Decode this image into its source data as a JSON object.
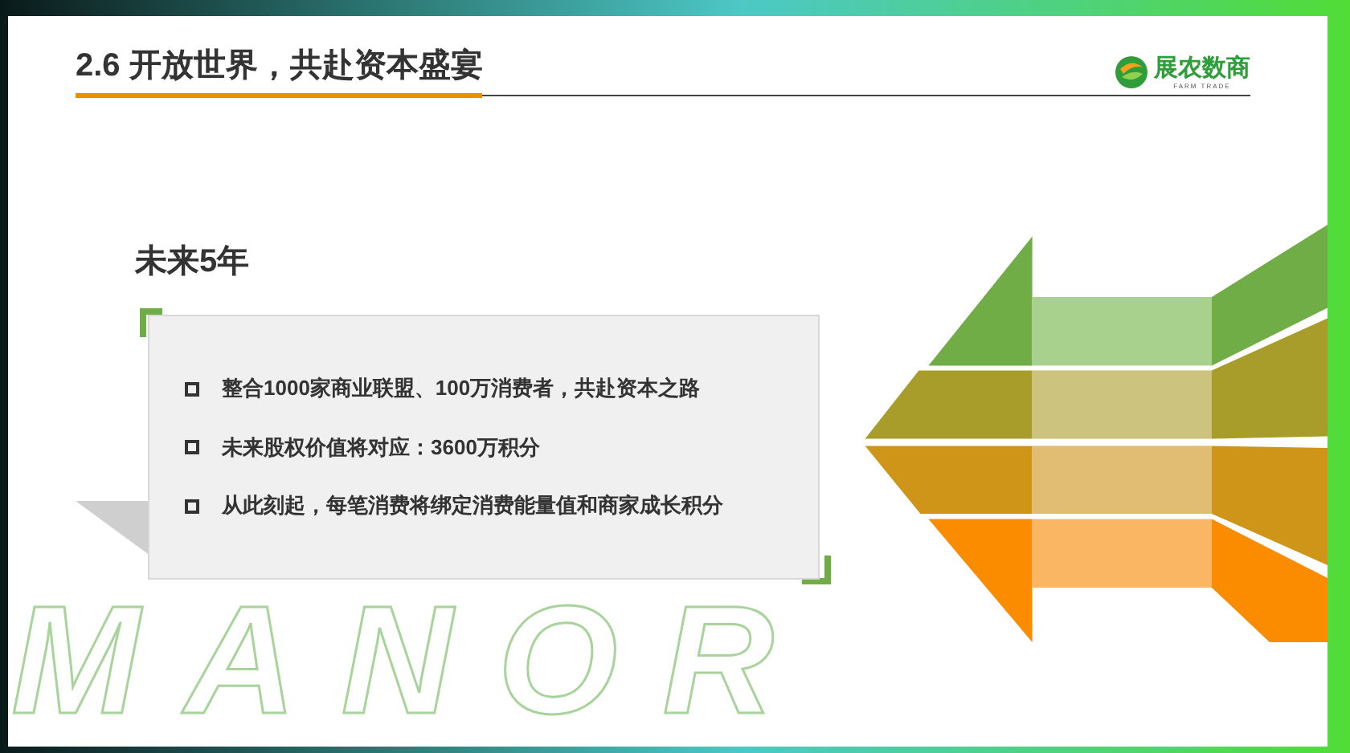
{
  "header": {
    "title": "2.6 开放世界，共赴资本盛宴",
    "logo": {
      "name": "展农数商",
      "tagline": "FARM TRADE"
    }
  },
  "section": {
    "heading": "未来5年",
    "bullets": [
      "整合1000家商业联盟、100万消费者，共赴资本之路",
      "未来股权价值将对应：3600万积分",
      "从此刻起，每笔消费将绑定消费能量值和商家成长积分"
    ]
  },
  "background_text": "MANOR"
}
